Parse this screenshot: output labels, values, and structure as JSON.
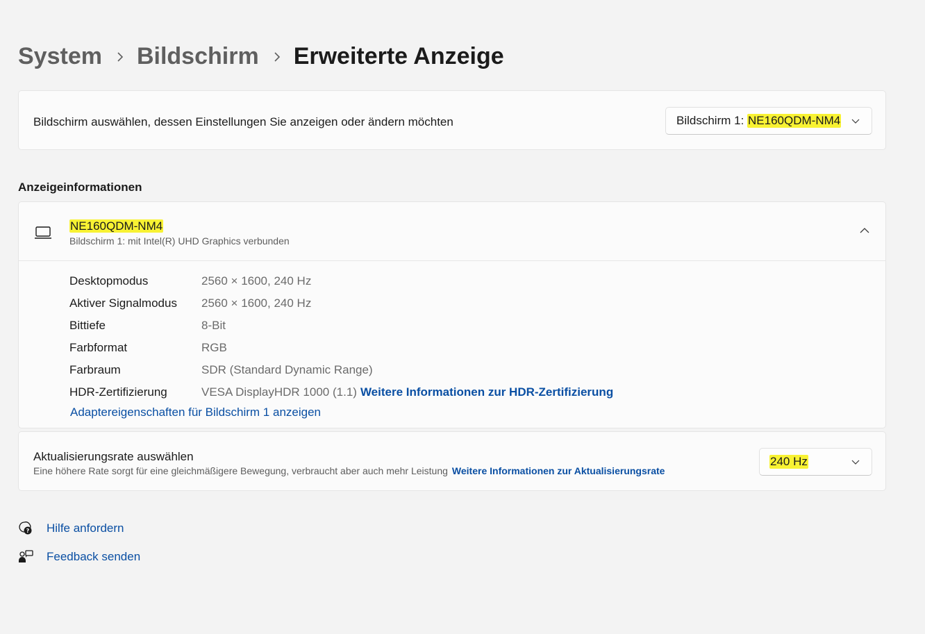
{
  "breadcrumb": {
    "items": [
      "System",
      "Bildschirm"
    ],
    "current": "Erweiterte Anzeige"
  },
  "select_display": {
    "label": "Bildschirm auswählen, dessen Einstellungen Sie anzeigen oder ändern möchten",
    "dropdown_prefix": "Bildschirm 1: ",
    "dropdown_value": "NE160QDM-NM4",
    "icon": "chevron-down-icon"
  },
  "display_info": {
    "section_title": "Anzeigeinformationen",
    "monitor_name": "NE160QDM-NM4",
    "monitor_sub": "Bildschirm 1: mit Intel(R) UHD Graphics verbunden",
    "icon": "laptop-icon",
    "collapse_icon": "chevron-up-icon",
    "rows": [
      {
        "key": "Desktopmodus",
        "value": "2560 × 1600, 240 Hz"
      },
      {
        "key": "Aktiver Signalmodus",
        "value": "2560 × 1600, 240 Hz"
      },
      {
        "key": "Bittiefe",
        "value": "8-Bit"
      },
      {
        "key": "Farbformat",
        "value": "RGB"
      },
      {
        "key": "Farbraum",
        "value": "SDR (Standard Dynamic Range)"
      },
      {
        "key": "HDR-Zertifizierung",
        "value": "VESA DisplayHDR 1000 (1.1)",
        "link": "Weitere Informationen zur HDR-Zertifizierung"
      }
    ],
    "adapter_link": "Adaptereigenschaften für Bildschirm 1 anzeigen"
  },
  "refresh_rate": {
    "title": "Aktualisierungsrate auswählen",
    "description": "Eine höhere Rate sorgt für eine gleichmäßigere Bewegung, verbraucht aber auch mehr Leistung",
    "link": "Weitere Informationen zur Aktualisierungsrate",
    "value": "240 Hz"
  },
  "footer": {
    "help": "Hilfe anfordern",
    "feedback": "Feedback senden"
  },
  "colors": {
    "accent_link": "#0a4fa3",
    "highlight": "#f8f233"
  }
}
